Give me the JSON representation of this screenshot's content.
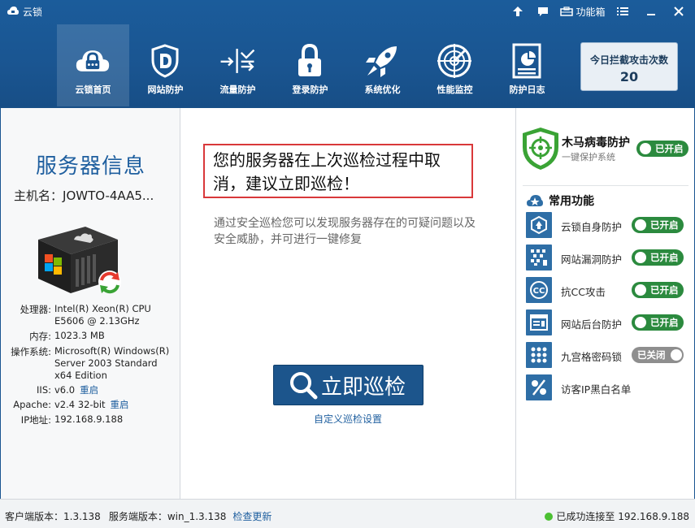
{
  "window": {
    "title": "云锁",
    "toolbox_label": "功能箱",
    "icons": [
      "app-cloud-lock-icon",
      "upgrade-arrow-icon",
      "feedback-icon",
      "toolbox-icon",
      "menu-icon",
      "minimize-icon",
      "close-icon"
    ]
  },
  "nav": {
    "items": [
      {
        "label": "云锁首页",
        "icon": "cloud-lock-icon",
        "active": true
      },
      {
        "label": "网站防护",
        "icon": "shield-d-icon"
      },
      {
        "label": "流量防护",
        "icon": "traffic-arrows-icon"
      },
      {
        "label": "登录防护",
        "icon": "padlock-icon"
      },
      {
        "label": "系统优化",
        "icon": "rocket-icon"
      },
      {
        "label": "性能监控",
        "icon": "radar-icon"
      },
      {
        "label": "防护日志",
        "icon": "log-document-icon"
      }
    ]
  },
  "attack_counter": {
    "title": "今日拦截攻击次数",
    "count": "20"
  },
  "server_info": {
    "title": "服务器信息",
    "host_label": "主机名：",
    "host_value": "JOWTO-4AA5...",
    "rows": [
      {
        "key": "处理器:",
        "value": "Intel(R) Xeon(R) CPU E5606  @ 2.13GHz",
        "link": ""
      },
      {
        "key": "内存:",
        "value": "1023.3 MB",
        "link": ""
      },
      {
        "key": "操作系统:",
        "value": "Microsoft(R) Windows(R) Server 2003 Standard x64 Edition",
        "link": ""
      },
      {
        "key": "IIS:",
        "value": "v6.0",
        "link": "重启"
      },
      {
        "key": "Apache:",
        "value": "v2.4 32-bit",
        "link": "重启"
      },
      {
        "key": "IP地址:",
        "value": "192.168.9.188",
        "link": ""
      }
    ]
  },
  "center": {
    "alert": "您的服务器在上次巡检过程中取消，建议立即巡检！",
    "description": "通过安全巡检您可以发现服务器存在的可疑问题以及安全威胁，并可进行一键修复",
    "scan_button": "立即巡检",
    "custom_link": "自定义巡检设置"
  },
  "right": {
    "trojan": {
      "title": "木马病毒防护",
      "subtitle": "一键保护系统",
      "toggle": "已开启",
      "on": true
    },
    "common_title": "常用功能",
    "features": [
      {
        "label": "云锁自身防护",
        "icon": "self-protect-icon",
        "toggle": "已开启",
        "on": true
      },
      {
        "label": "网站漏洞防护",
        "icon": "vulnerability-icon",
        "toggle": "已开启",
        "on": true
      },
      {
        "label": "抗CC攻击",
        "icon": "cc-attack-icon",
        "toggle": "已开启",
        "on": true
      },
      {
        "label": "网站后台防护",
        "icon": "backend-protect-icon",
        "toggle": "已开启",
        "on": true
      },
      {
        "label": "九宫格密码锁",
        "icon": "grid-lock-icon",
        "toggle": "已关闭",
        "on": false
      },
      {
        "label": "访客IP黑白名单",
        "icon": "ip-list-icon",
        "toggle": "",
        "on": null
      }
    ]
  },
  "status": {
    "client_version": "客户端版本：1.3.138",
    "server_version": "服务端版本：win_1.3.138",
    "check_update": "检查更新",
    "connection": "已成功连接至 192.168.9.188",
    "accent": "#1a5591",
    "on_color": "#2b8a3e",
    "alert_border": "#d9383a"
  }
}
